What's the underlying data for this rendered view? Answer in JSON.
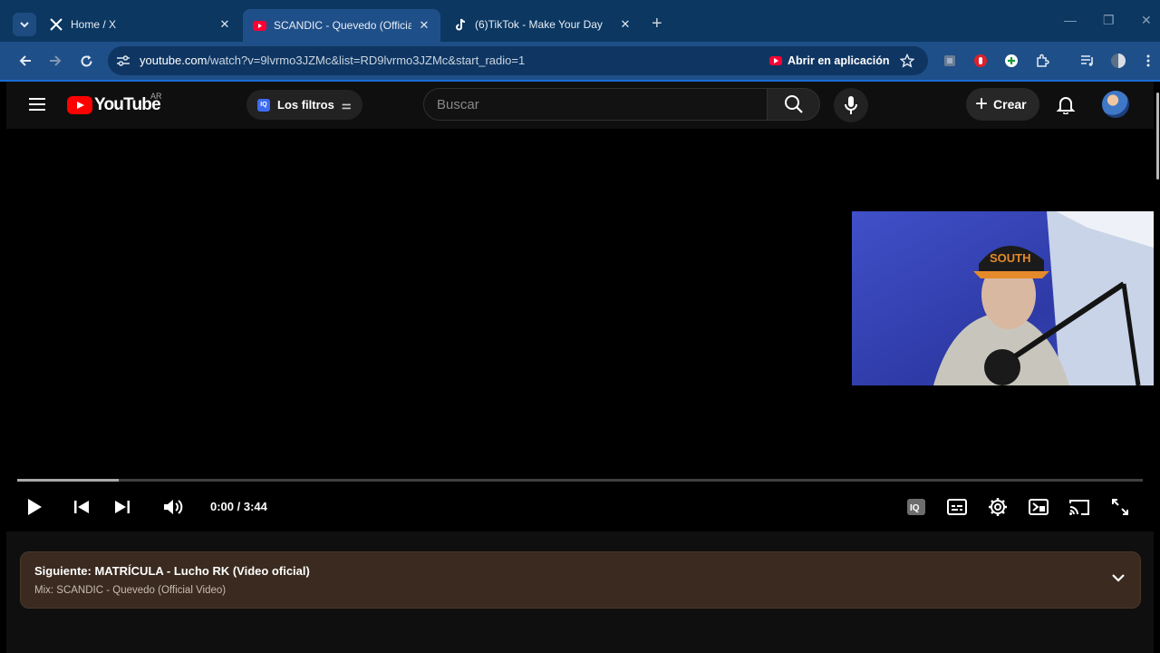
{
  "browser": {
    "tabs": [
      {
        "title": "Home / X",
        "favicon": "x-icon",
        "active": false
      },
      {
        "title": "SCANDIC - Quevedo (Official V",
        "favicon": "youtube-icon",
        "active": true
      },
      {
        "title": "(6)TikTok - Make Your Day",
        "favicon": "tiktok-icon",
        "active": false
      }
    ],
    "url_host": "youtube.com",
    "url_rest": "/watch?v=9lvrmo3JZMc&list=RD9lvrmo3JZMc&start_radio=1",
    "open_in_app": "Abrir en aplicación"
  },
  "youtube": {
    "logo_text": "YouTube",
    "country_code": "AR",
    "filters_label": "Los filtros",
    "search_placeholder": "Buscar",
    "create_label": "Crear"
  },
  "player": {
    "current_time": "0:00",
    "separator": " / ",
    "duration": "3:44",
    "progress_fraction": 0.09
  },
  "upnext": {
    "label": "Siguiente:",
    "title": "MATRÍCULA - Lucho RK (Video oficial)",
    "mix": "Mix: SCANDIC - Quevedo (Official Video)"
  },
  "colors": {
    "chrome_tabbar": "#0b3761",
    "chrome_toolbar": "#1f4f88",
    "youtube_red": "#ff0000",
    "upnext_bg": "#3a2a1f"
  }
}
